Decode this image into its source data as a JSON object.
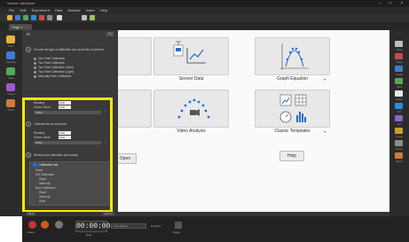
{
  "window": {
    "title": "Vernier LabQuest",
    "controls": [
      "–",
      "□",
      "×"
    ]
  },
  "menubar": {
    "items": [
      "File",
      "Edit",
      "Experiment",
      "Data",
      "Analyze",
      "Insert",
      "Help"
    ]
  },
  "tabs": [
    {
      "label": "Page 1"
    }
  ],
  "leftbar": {
    "items": [
      {
        "label": "Files"
      },
      {
        "label": "Sensors"
      },
      {
        "label": "Data"
      },
      {
        "label": "Graph"
      },
      {
        "label": "Tools"
      }
    ]
  },
  "panel": {
    "title": "Fit",
    "question": "Choose the type of calibration you would like to perform:",
    "options": [
      "One Point Calibration",
      "Two Point Calibration",
      "Two Point Calibration (Dark)",
      "Two Point Calibration (Light)",
      "Manually Enter Calibration"
    ],
    "step1": {
      "number": "1",
      "reading_label": "Reading",
      "reading_value": "0.00",
      "known_label": "Known Value",
      "known_value": "0.00",
      "button": "Keep"
    },
    "step2": {
      "number": "2",
      "instruction": "Calibrate the second point",
      "reading_label": "Reading",
      "reading_value": "0.00",
      "known_label": "Known Value",
      "known_value": "0.00",
      "button": "Keep"
    },
    "step3": {
      "number": "3",
      "instruction": "Review your calibration and accept:"
    },
    "info": {
      "heading": "Calibration info",
      "lines": [
        "Slope",
        "Old Calibration",
        "Slope",
        "Intercept",
        "New Calibration",
        "Slope",
        "Intercept",
        "Units"
      ]
    },
    "footer_left": "Back",
    "footer_right": "Cancel"
  },
  "tiles": [
    {
      "label": "",
      "icon": "sensor-icon"
    },
    {
      "label": "Sensor Data",
      "icon": "sensor-data-icon"
    },
    {
      "label": "Graph Equation",
      "icon": "parabola-icon"
    },
    {
      "label": "",
      "icon": "partial-icon"
    },
    {
      "label": "Video Analysis",
      "icon": "video-analysis-icon"
    },
    {
      "label": "Classic Templates",
      "icon": "templates-icon"
    }
  ],
  "buttons": {
    "open": "Open",
    "help": "Help"
  },
  "bottom": {
    "collect_label": "Collect",
    "timer": "00:00:00",
    "rate_label": "Rate",
    "duration_label": "Duration",
    "mode_label": "Time Based",
    "extra_label": "Trigger"
  },
  "rightbar": {
    "labels": [
      "Page",
      "Data",
      "Graph",
      "Table",
      "Meter",
      "FFT",
      "Text",
      "Image",
      "Notes",
      "Movie"
    ]
  },
  "colors": {
    "highlight": "#ffe600",
    "panel": "#3a3a3a",
    "chrome": "#1d1d1d",
    "accent_blue": "#1f6fd0"
  }
}
